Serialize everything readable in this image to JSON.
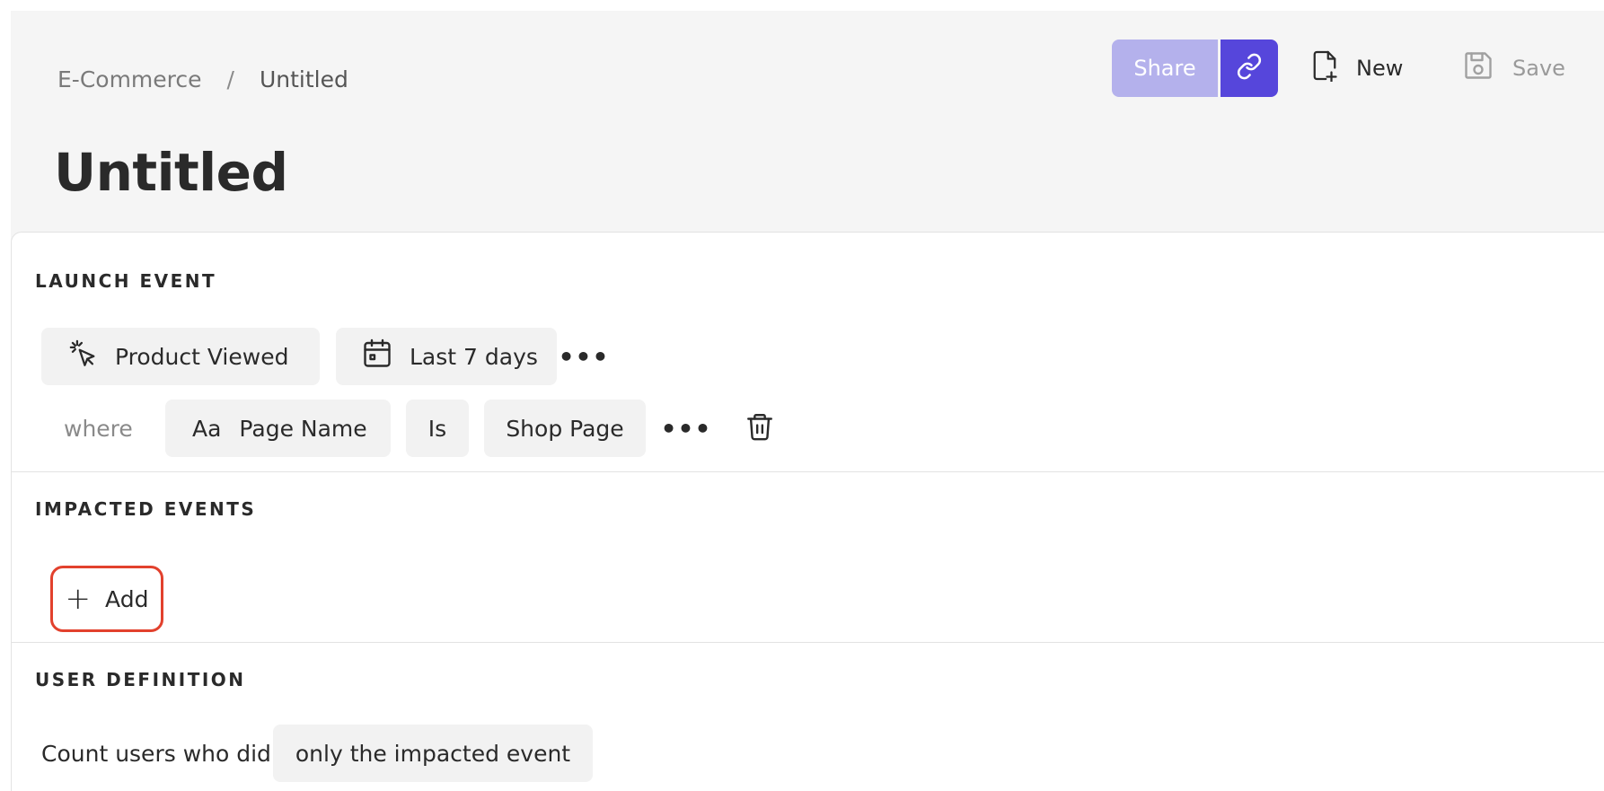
{
  "breadcrumb": {
    "parent": "E-Commerce",
    "separator": "/",
    "current": "Untitled"
  },
  "page_title": "Untitled",
  "header_actions": {
    "share_label": "Share",
    "new_label": "New",
    "save_label": "Save"
  },
  "launch_event": {
    "section_label": "LAUNCH EVENT",
    "event_name": "Product Viewed",
    "date_range": "Last 7 days",
    "more": "•••",
    "filter": {
      "where_label": "where",
      "property_type_glyph": "Aa",
      "property_name": "Page Name",
      "operator": "Is",
      "value": "Shop Page",
      "more": "•••"
    }
  },
  "impacted_events": {
    "section_label": "IMPACTED EVENTS",
    "add_label": "Add"
  },
  "user_definition": {
    "section_label": "USER DEFINITION",
    "prefix": "Count users who did",
    "selected_option": "only the impacted event"
  },
  "colors": {
    "accent": "#5646db",
    "accent_light": "#b4b1ec",
    "highlight": "#e2412d",
    "header_bg": "#f5f5f5",
    "chip_bg": "#f2f2f2"
  },
  "icons": {
    "link": "link-icon",
    "new": "new-file-icon",
    "save": "save-icon",
    "event": "cursor-click-icon",
    "date": "calendar-icon",
    "delete": "trash-icon",
    "add": "plus-icon"
  }
}
